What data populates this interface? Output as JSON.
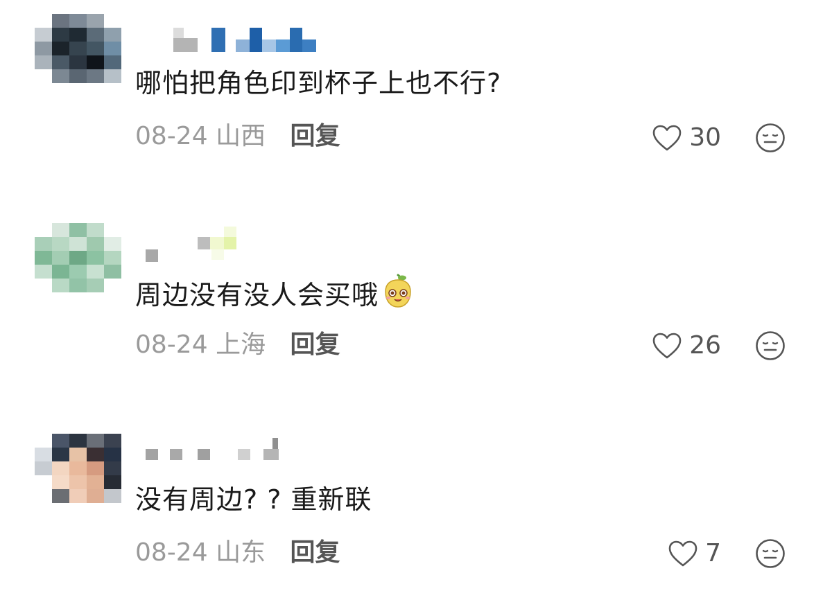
{
  "comments": [
    {
      "text": "哪怕把角色印到杯子上也不行?",
      "date": "08-24",
      "location": "山西",
      "reply_label": "回复",
      "likes": "30",
      "has_emoji": false
    },
    {
      "text": "周边没有没人会买哦",
      "date": "08-24",
      "location": "上海",
      "reply_label": "回复",
      "likes": "26",
      "has_emoji": true,
      "emoji": "mango-face-emoji"
    },
    {
      "text": "没有周边? ? 重新联",
      "date": "08-24",
      "location": "山东",
      "reply_label": "回复",
      "likes": "7",
      "has_emoji": false
    }
  ],
  "icons": {
    "like": "heart-outline-icon",
    "dislike": "neutral-face-icon"
  },
  "colors": {
    "meta_gray": "#9a9a9a",
    "reply_gray": "#555555",
    "text": "#1a1a1a"
  }
}
